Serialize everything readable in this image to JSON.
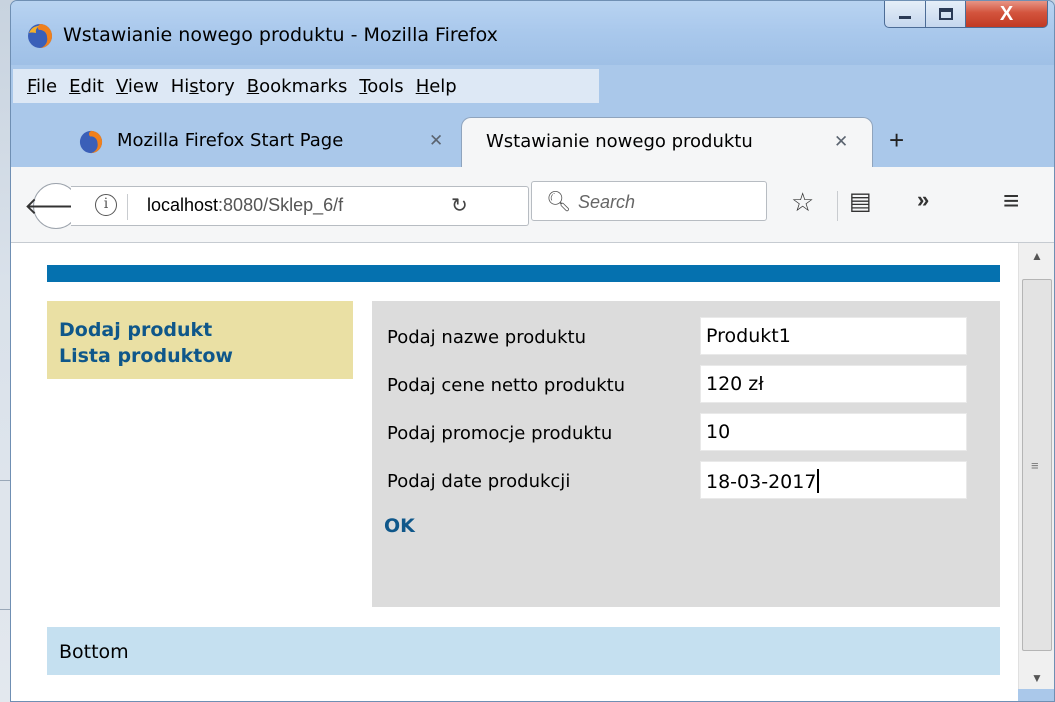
{
  "window": {
    "title": "Wstawianie nowego produktu - Mozilla Firefox",
    "close_label": "X"
  },
  "menubar": {
    "items": [
      {
        "label": "File",
        "accel": "F"
      },
      {
        "label": "Edit",
        "accel": "E"
      },
      {
        "label": "View",
        "accel": "V"
      },
      {
        "label": "History",
        "accel": "s"
      },
      {
        "label": "Bookmarks",
        "accel": "B"
      },
      {
        "label": "Tools",
        "accel": "T"
      },
      {
        "label": "Help",
        "accel": "H"
      }
    ]
  },
  "tabs": [
    {
      "label": "Mozilla Firefox Start Page",
      "active": false
    },
    {
      "label": "Wstawianie nowego produktu",
      "active": true
    }
  ],
  "navbar": {
    "url_host": "localhost",
    "url_path": ":8080/Sklep_6/f",
    "search_placeholder": "Search"
  },
  "page": {
    "accent_color": "#0571af",
    "sidebar": {
      "links": [
        "Dodaj produkt",
        "Lista produktow"
      ]
    },
    "form": {
      "fields": [
        {
          "label": "Podaj nazwe produktu",
          "value": "Produkt1"
        },
        {
          "label": "Podaj cene netto produktu",
          "value": "120 zł"
        },
        {
          "label": "Podaj promocje produktu",
          "value": "10"
        },
        {
          "label": "Podaj date produkcji",
          "value": "18-03-2017"
        }
      ],
      "submit_label": "OK"
    },
    "footer": "Bottom"
  }
}
